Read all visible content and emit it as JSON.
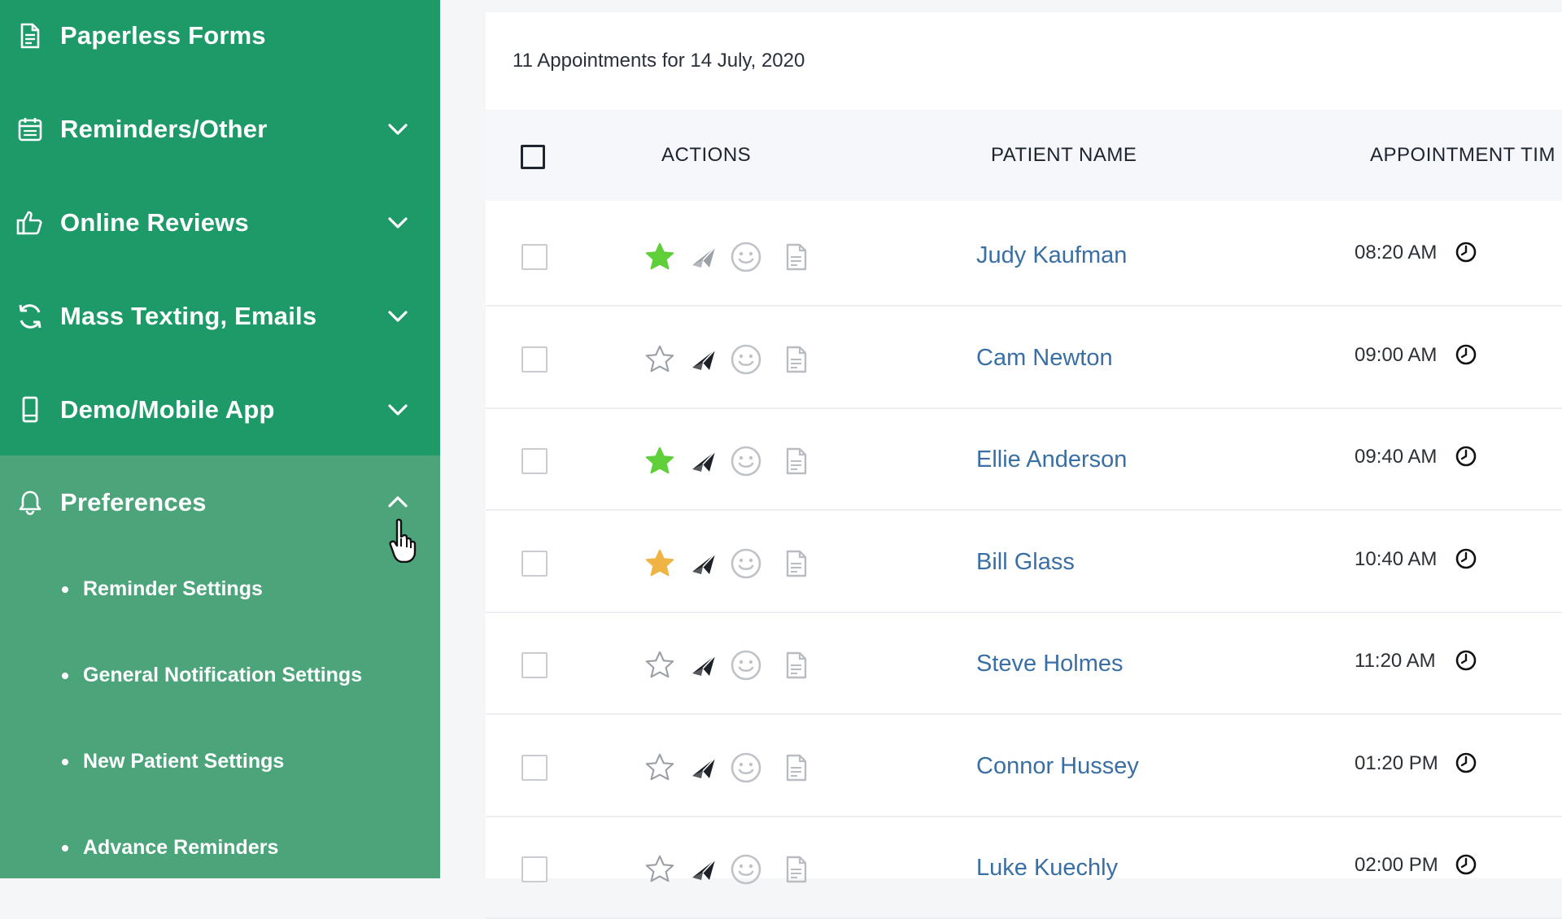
{
  "sidebar": {
    "items": [
      {
        "label": "Paperless Forms",
        "icon": "document-icon"
      },
      {
        "label": "Reminders/Other",
        "icon": "calendar-icon"
      },
      {
        "label": "Online Reviews",
        "icon": "thumbs-up-icon"
      },
      {
        "label": "Mass Texting, Emails",
        "icon": "refresh-icon"
      },
      {
        "label": "Demo/Mobile App",
        "icon": "mobile-icon"
      },
      {
        "label": "Preferences",
        "icon": "bell-icon"
      }
    ],
    "preferences_subitems": [
      {
        "label": "Reminder Settings"
      },
      {
        "label": "General Notification Settings"
      },
      {
        "label": "New Patient Settings"
      },
      {
        "label": "Advance Reminders"
      }
    ]
  },
  "main": {
    "title_count": "11",
    "title_text": "Appointments for 14 July, 2020",
    "columns": {
      "actions": "ACTIONS",
      "patient_name": "PATIENT NAME",
      "appointment_time": "APPOINTMENT TIM"
    },
    "rows": [
      {
        "name": "Judy Kaufman",
        "time": "08:20 AM",
        "star": "green",
        "send": "gray"
      },
      {
        "name": "Cam Newton",
        "time": "09:00 AM",
        "star": "empty",
        "send": "dark"
      },
      {
        "name": "Ellie Anderson",
        "time": "09:40 AM",
        "star": "green",
        "send": "dark"
      },
      {
        "name": "Bill Glass",
        "time": "10:40 AM",
        "star": "gold",
        "send": "dark"
      },
      {
        "name": "Steve Holmes",
        "time": "11:20 AM",
        "star": "empty",
        "send": "dark"
      },
      {
        "name": "Connor Hussey",
        "time": "01:20 PM",
        "star": "empty",
        "send": "dark"
      },
      {
        "name": "Luke Kuechly",
        "time": "02:00 PM",
        "star": "empty",
        "send": "dark"
      }
    ]
  },
  "colors": {
    "sidebar_green": "#1e9a68",
    "preferences_green": "#4ba47a",
    "link_blue": "#3a6fa5",
    "star_green": "#5fcf3a",
    "star_gold": "#f0b445"
  }
}
